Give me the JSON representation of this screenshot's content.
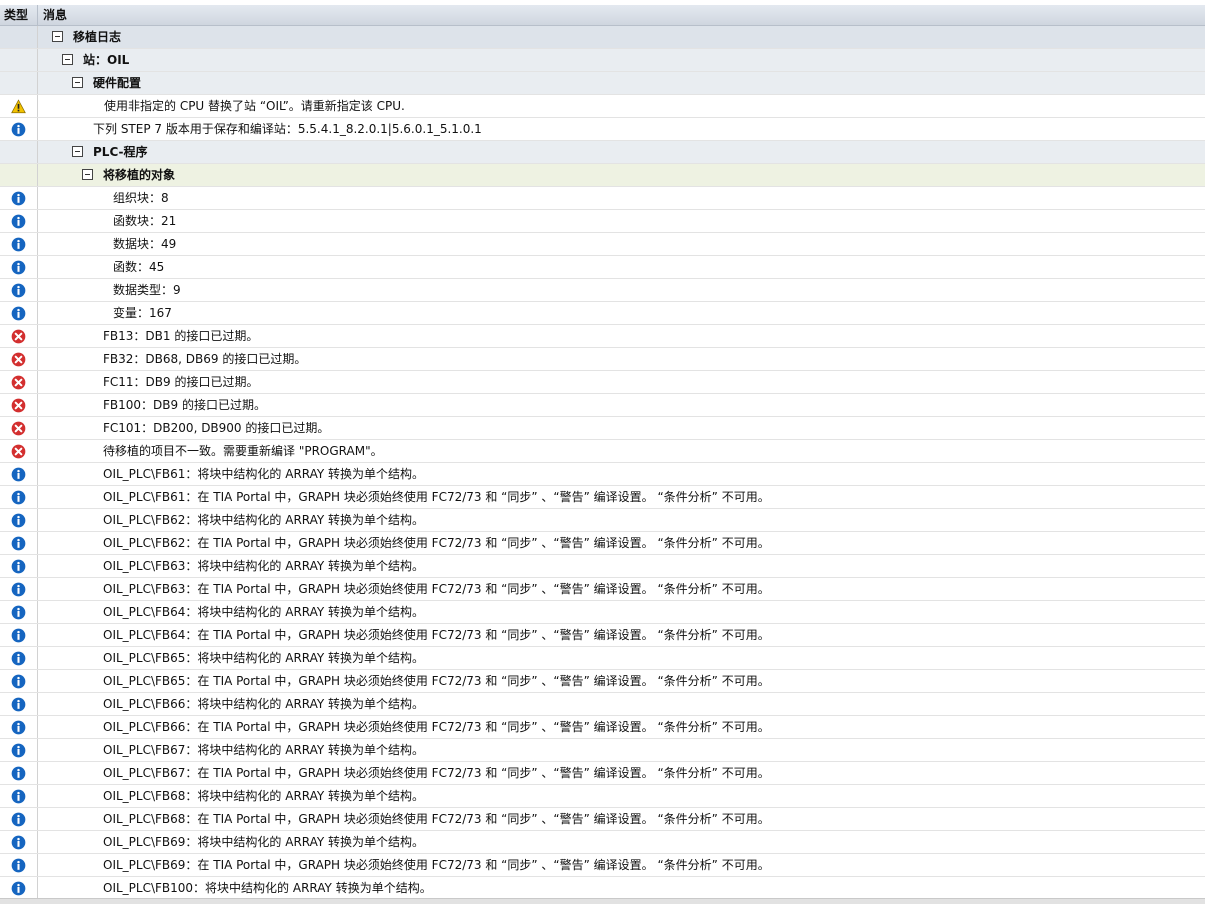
{
  "header": {
    "type_col": "类型",
    "message_col": "消息"
  },
  "rows": [
    {
      "kind": "group",
      "level": 1,
      "text": "移植日志",
      "icon": ""
    },
    {
      "kind": "group",
      "level": 2,
      "text": "站：OIL",
      "icon": ""
    },
    {
      "kind": "group",
      "level": 3,
      "text": "硬件配置",
      "icon": ""
    },
    {
      "kind": "msg",
      "indent": 104,
      "text": "使用非指定的  CPU 替换了站 “OIL”。请重新指定该  CPU.",
      "icon": "warning-icon"
    },
    {
      "kind": "msg",
      "indent": 93,
      "text": "下列  STEP 7 版本用于保存和编译站：5.5.4.1_8.2.0.1|5.6.0.1_5.1.0.1",
      "icon": "info-icon"
    },
    {
      "kind": "group",
      "level": 3,
      "text": "PLC-程序",
      "icon": ""
    },
    {
      "kind": "group",
      "level": 4,
      "text": "将移植的对象",
      "icon": ""
    },
    {
      "kind": "msg",
      "indent": 113,
      "text": "组织块：8",
      "icon": "info-icon"
    },
    {
      "kind": "msg",
      "indent": 113,
      "text": "函数块：21",
      "icon": "info-icon"
    },
    {
      "kind": "msg",
      "indent": 113,
      "text": "数据块：49",
      "icon": "info-icon"
    },
    {
      "kind": "msg",
      "indent": 113,
      "text": "函数：45",
      "icon": "info-icon"
    },
    {
      "kind": "msg",
      "indent": 113,
      "text": "数据类型：9",
      "icon": "info-icon"
    },
    {
      "kind": "msg",
      "indent": 113,
      "text": "变量：167",
      "icon": "info-icon"
    },
    {
      "kind": "msg",
      "indent": 103,
      "text": "FB13：DB1 的接口已过期。",
      "icon": "error-icon"
    },
    {
      "kind": "msg",
      "indent": 103,
      "text": "FB32：DB68, DB69 的接口已过期。",
      "icon": "error-icon"
    },
    {
      "kind": "msg",
      "indent": 103,
      "text": "FC11：DB9 的接口已过期。",
      "icon": "error-icon"
    },
    {
      "kind": "msg",
      "indent": 103,
      "text": "FB100：DB9 的接口已过期。",
      "icon": "error-icon"
    },
    {
      "kind": "msg",
      "indent": 103,
      "text": "FC101：DB200, DB900 的接口已过期。",
      "icon": "error-icon"
    },
    {
      "kind": "msg",
      "indent": 103,
      "text": "待移植的项目不一致。需要重新编译  \"PROGRAM\"。",
      "icon": "error-icon"
    },
    {
      "kind": "msg",
      "indent": 103,
      "text": "OIL_PLC\\FB61：将块中结构化的  ARRAY 转换为单个结构。",
      "icon": "info-icon"
    },
    {
      "kind": "msg",
      "indent": 103,
      "text": "OIL_PLC\\FB61：在  TIA Portal 中，GRAPH 块必须始终使用  FC72/73 和 “同步” 、“警告” 编译设置。 “条件分析” 不可用。",
      "icon": "info-icon"
    },
    {
      "kind": "msg",
      "indent": 103,
      "text": "OIL_PLC\\FB62：将块中结构化的  ARRAY 转换为单个结构。",
      "icon": "info-icon"
    },
    {
      "kind": "msg",
      "indent": 103,
      "text": "OIL_PLC\\FB62：在  TIA Portal 中，GRAPH 块必须始终使用  FC72/73 和 “同步” 、“警告” 编译设置。 “条件分析” 不可用。",
      "icon": "info-icon"
    },
    {
      "kind": "msg",
      "indent": 103,
      "text": "OIL_PLC\\FB63：将块中结构化的  ARRAY 转换为单个结构。",
      "icon": "info-icon"
    },
    {
      "kind": "msg",
      "indent": 103,
      "text": "OIL_PLC\\FB63：在  TIA Portal 中，GRAPH 块必须始终使用  FC72/73 和 “同步” 、“警告” 编译设置。 “条件分析” 不可用。",
      "icon": "info-icon"
    },
    {
      "kind": "msg",
      "indent": 103,
      "text": "OIL_PLC\\FB64：将块中结构化的  ARRAY 转换为单个结构。",
      "icon": "info-icon"
    },
    {
      "kind": "msg",
      "indent": 103,
      "text": "OIL_PLC\\FB64：在  TIA Portal 中，GRAPH 块必须始终使用  FC72/73 和 “同步” 、“警告” 编译设置。 “条件分析” 不可用。",
      "icon": "info-icon"
    },
    {
      "kind": "msg",
      "indent": 103,
      "text": "OIL_PLC\\FB65：将块中结构化的  ARRAY 转换为单个结构。",
      "icon": "info-icon"
    },
    {
      "kind": "msg",
      "indent": 103,
      "text": "OIL_PLC\\FB65：在  TIA Portal 中，GRAPH 块必须始终使用  FC72/73 和 “同步” 、“警告” 编译设置。 “条件分析” 不可用。",
      "icon": "info-icon"
    },
    {
      "kind": "msg",
      "indent": 103,
      "text": "OIL_PLC\\FB66：将块中结构化的  ARRAY 转换为单个结构。",
      "icon": "info-icon"
    },
    {
      "kind": "msg",
      "indent": 103,
      "text": "OIL_PLC\\FB66：在  TIA Portal 中，GRAPH 块必须始终使用  FC72/73 和 “同步” 、“警告” 编译设置。 “条件分析” 不可用。",
      "icon": "info-icon"
    },
    {
      "kind": "msg",
      "indent": 103,
      "text": "OIL_PLC\\FB67：将块中结构化的  ARRAY 转换为单个结构。",
      "icon": "info-icon"
    },
    {
      "kind": "msg",
      "indent": 103,
      "text": "OIL_PLC\\FB67：在  TIA Portal 中，GRAPH 块必须始终使用  FC72/73 和 “同步” 、“警告” 编译设置。 “条件分析” 不可用。",
      "icon": "info-icon"
    },
    {
      "kind": "msg",
      "indent": 103,
      "text": "OIL_PLC\\FB68：将块中结构化的  ARRAY 转换为单个结构。",
      "icon": "info-icon"
    },
    {
      "kind": "msg",
      "indent": 103,
      "text": "OIL_PLC\\FB68：在  TIA Portal 中，GRAPH 块必须始终使用  FC72/73 和 “同步” 、“警告” 编译设置。 “条件分析” 不可用。",
      "icon": "info-icon"
    },
    {
      "kind": "msg",
      "indent": 103,
      "text": "OIL_PLC\\FB69：将块中结构化的  ARRAY 转换为单个结构。",
      "icon": "info-icon"
    },
    {
      "kind": "msg",
      "indent": 103,
      "text": "OIL_PLC\\FB69：在  TIA Portal 中，GRAPH 块必须始终使用  FC72/73 和 “同步” 、“警告” 编译设置。 “条件分析” 不可用。",
      "icon": "info-icon"
    },
    {
      "kind": "msg",
      "indent": 103,
      "text": "OIL_PLC\\FB100：将块中结构化的  ARRAY 转换为单个结构。",
      "icon": "info-icon"
    }
  ],
  "colors": {
    "info": "#1565c0",
    "error": "#d32f2f",
    "warning": "#f2c200"
  }
}
